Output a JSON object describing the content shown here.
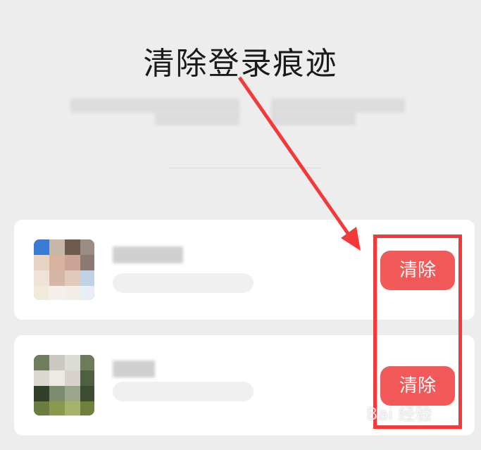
{
  "page": {
    "title": "清除登录痕迹"
  },
  "accounts": [
    {
      "clear_label": "清除"
    },
    {
      "clear_label": "清除"
    }
  ],
  "watermark": {
    "text": "Bai 经验"
  },
  "colors": {
    "accent": "#f25a5a",
    "highlight": "#f23a3a",
    "background": "#ededed"
  }
}
